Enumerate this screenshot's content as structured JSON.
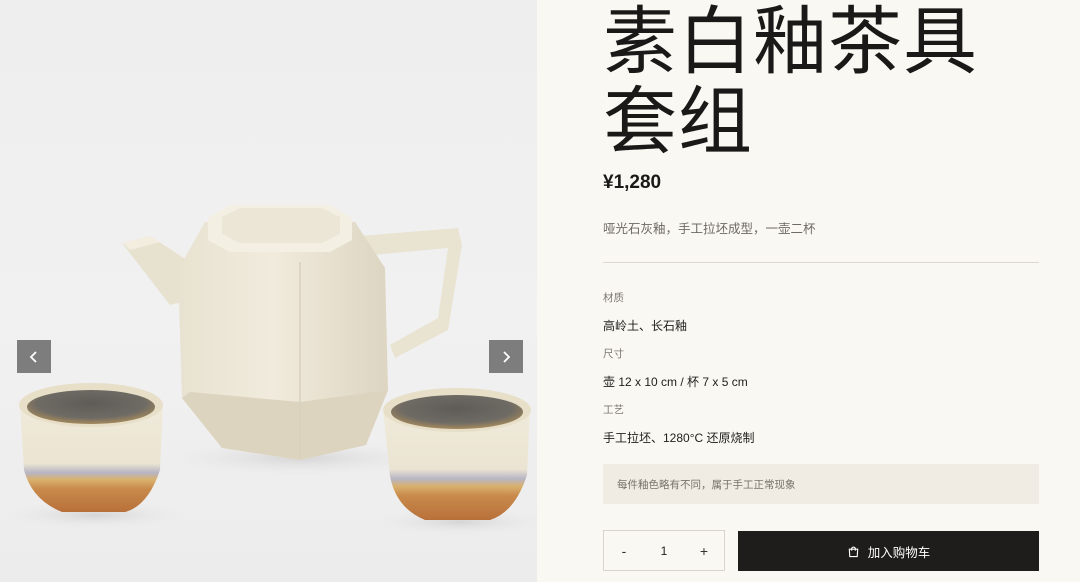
{
  "product": {
    "title": "素白釉茶具套组",
    "price": "¥1,280",
    "description": "哑光石灰釉，手工拉坯成型，一壶二杯"
  },
  "gallery": {
    "image_alt": "teapot-and-two-cups-photo",
    "prev_icon": "chevron-left-icon",
    "next_icon": "chevron-right-icon"
  },
  "specs": [
    {
      "label": "材质",
      "value": "高岭土、长石釉"
    },
    {
      "label": "尺寸",
      "value": "壶 12 x 10 cm / 杯 7 x 5 cm"
    },
    {
      "label": "工艺",
      "value": "手工拉坯、1280°C 还原烧制"
    }
  ],
  "notice": "每件釉色略有不同，属于手工正常现象",
  "quantity": {
    "minus": "-",
    "value": "1",
    "plus": "+"
  },
  "cart": {
    "icon": "shopping-bag-icon",
    "label": "加入购物车"
  },
  "colors": {
    "accent": "#1e1d1b",
    "panel_bg": "#faf8f3",
    "nav_button": "#7d7d7d"
  }
}
